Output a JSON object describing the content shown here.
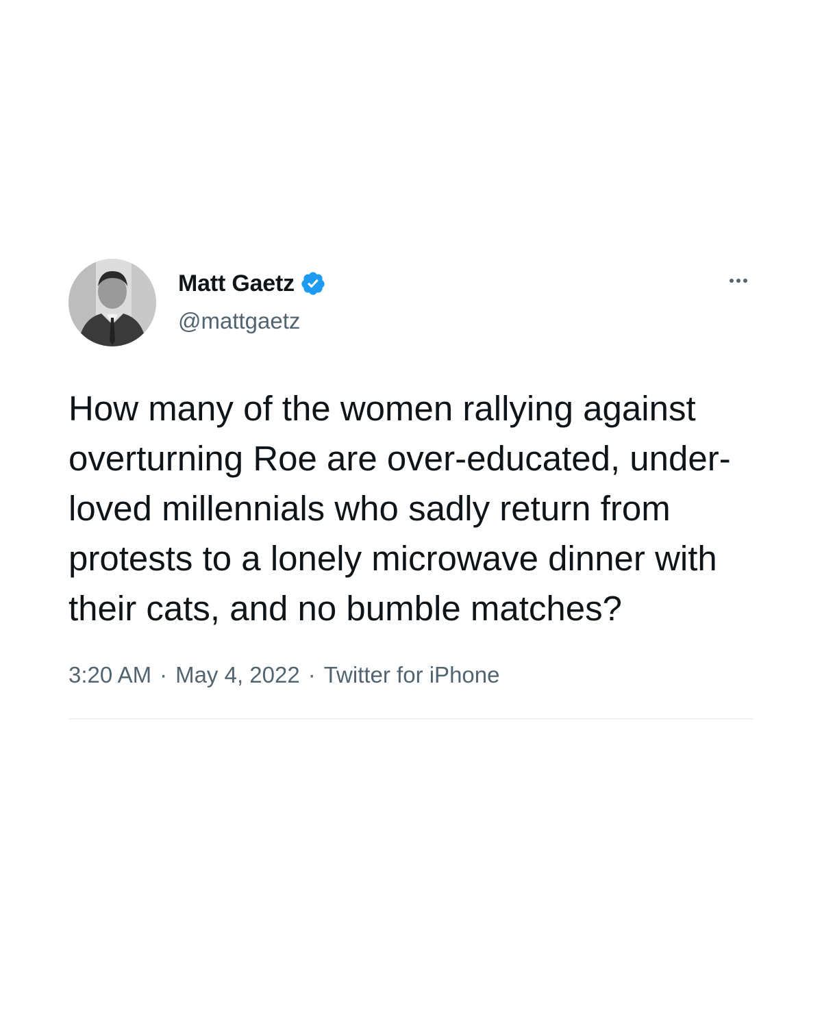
{
  "author": {
    "display_name": "Matt Gaetz",
    "handle": "@mattgaetz",
    "verified": true,
    "avatar_icon": "profile-photo-grayscale"
  },
  "tweet": {
    "text": "How many of the women rallying against overturning Roe are over-educated, under-loved millennials who sadly return from protests to a lonely microwave dinner with their cats, and no bumble matches?",
    "time": "3:20 AM",
    "date": "May 4, 2022",
    "source": "Twitter for iPhone",
    "separator": "·"
  },
  "icons": {
    "verified": "verified-badge-icon",
    "more": "more-options-icon"
  },
  "colors": {
    "text_primary": "#0f1419",
    "text_secondary": "#536471",
    "verified_blue": "#1d9bf0",
    "divider": "#eff3f4"
  }
}
